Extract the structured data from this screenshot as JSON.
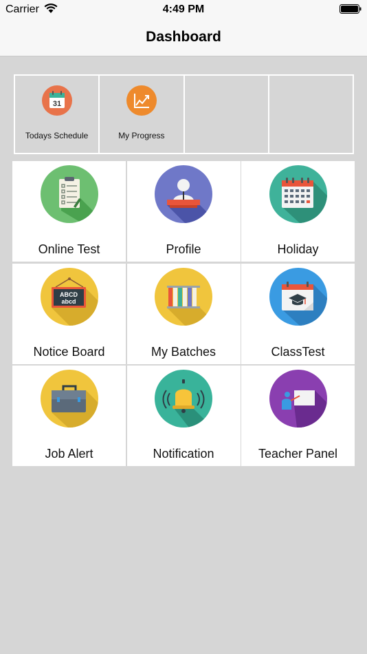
{
  "status_bar": {
    "carrier": "Carrier",
    "time": "4:49 PM"
  },
  "nav": {
    "title": "Dashboard"
  },
  "quick_actions": [
    {
      "label": "Todays Schedule",
      "icon": "calendar-31-icon",
      "color": "#e8734a"
    },
    {
      "label": "My Progress",
      "icon": "chart-line-icon",
      "color": "#ee8a2c"
    },
    {
      "label": "",
      "icon": ""
    },
    {
      "label": "",
      "icon": ""
    }
  ],
  "tiles": [
    {
      "label": "Online Test",
      "icon": "clipboard-checklist-icon",
      "color": "#6dbf71"
    },
    {
      "label": "Profile",
      "icon": "user-podium-icon",
      "color": "#6f78c8"
    },
    {
      "label": "Holiday",
      "icon": "calendar-icon",
      "color": "#3fb29a"
    },
    {
      "label": "Notice Board",
      "icon": "blackboard-icon",
      "color": "#f0c53d"
    },
    {
      "label": "My Batches",
      "icon": "books-icon",
      "color": "#f0c53d"
    },
    {
      "label": "ClassTest",
      "icon": "class-test-icon",
      "color": "#3a9be2"
    },
    {
      "label": "Job Alert",
      "icon": "briefcase-icon",
      "color": "#f0c53d"
    },
    {
      "label": "Notification",
      "icon": "bell-icon",
      "color": "#39b39a"
    },
    {
      "label": "Teacher Panel",
      "icon": "teacher-icon",
      "color": "#8a3fb0"
    }
  ],
  "icon_text": {
    "abcd_upper": "ABCD",
    "abcd_lower": "abcd",
    "calendar_day": "31"
  }
}
